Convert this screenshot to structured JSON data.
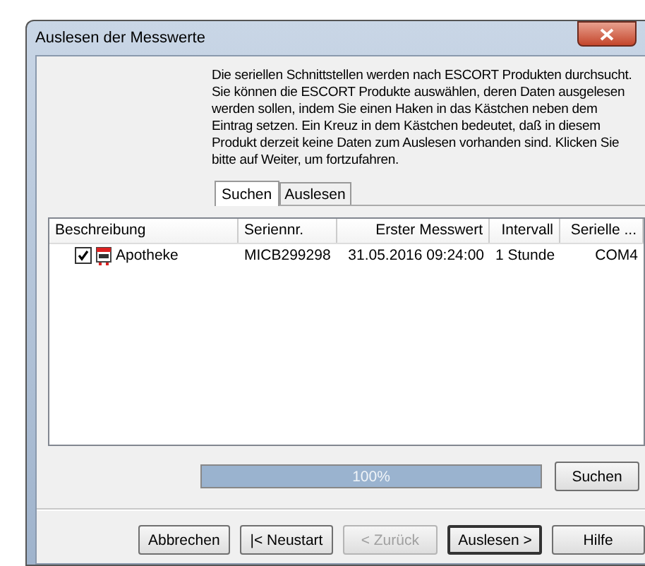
{
  "window": {
    "title": "Auslesen der Messwerte"
  },
  "intro": "Die seriellen Schnittstellen werden nach ESCORT Produkten durchsucht. Sie können die ESCORT Produkte auswählen, deren Daten ausgelesen werden sollen, indem Sie einen Haken in das Kästchen neben dem Eintrag setzen. Ein Kreuz in dem Kästchen bedeutet, daß in diesem Produkt derzeit keine Daten zum Auslesen vorhanden sind. Klicken Sie bitte auf Weiter, um fortzufahren.",
  "tabs": [
    {
      "label": "Suchen",
      "selected": true
    },
    {
      "label": "Auslesen",
      "selected": false
    }
  ],
  "table": {
    "columns": [
      "Beschreibung",
      "Seriennr.",
      "Erster Messwert",
      "Intervall",
      "Serielle ..."
    ],
    "rows": [
      {
        "checked": true,
        "cells": [
          "Apotheke",
          "MICB299298",
          "31.05.2016  09:24:00",
          "1 Stunde",
          "COM4"
        ]
      }
    ]
  },
  "progress": {
    "level": 1,
    "reading": "100%"
  },
  "search_button": "Suchen",
  "buttons": [
    {
      "label": "Abbrechen",
      "disabled": false,
      "default": false
    },
    {
      "label": "|< Neustart",
      "disabled": false,
      "default": false
    },
    {
      "label": "< Zurück",
      "disabled": true,
      "default": false
    },
    {
      "label": "Auslesen >",
      "disabled": false,
      "default": true
    },
    {
      "label": "Hilfe",
      "disabled": false,
      "default": false
    }
  ]
}
